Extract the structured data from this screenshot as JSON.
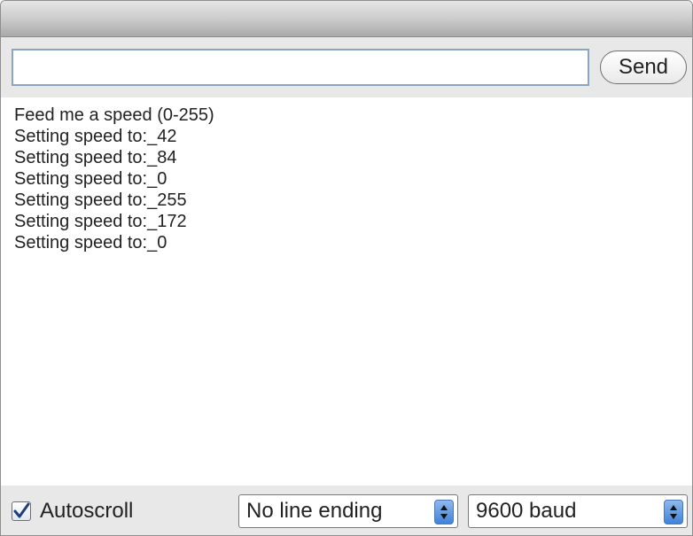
{
  "input": {
    "value": "",
    "placeholder": ""
  },
  "toolbar": {
    "send_label": "Send"
  },
  "monitor": {
    "lines": [
      "Feed me a speed (0-255)",
      "Setting speed to:_42",
      "Setting speed to:_84",
      "Setting speed to:_0",
      "Setting speed to:_255",
      "Setting speed to:_172",
      "Setting speed to:_0"
    ]
  },
  "statusbar": {
    "autoscroll": {
      "label": "Autoscroll",
      "checked": true
    },
    "line_ending": {
      "selected": "No line ending"
    },
    "baud": {
      "selected": "9600 baud"
    }
  },
  "colors": {
    "input_border": "#8aa6c2",
    "stepper_blue": "#3f83d9",
    "background": "#e8e8e8"
  }
}
